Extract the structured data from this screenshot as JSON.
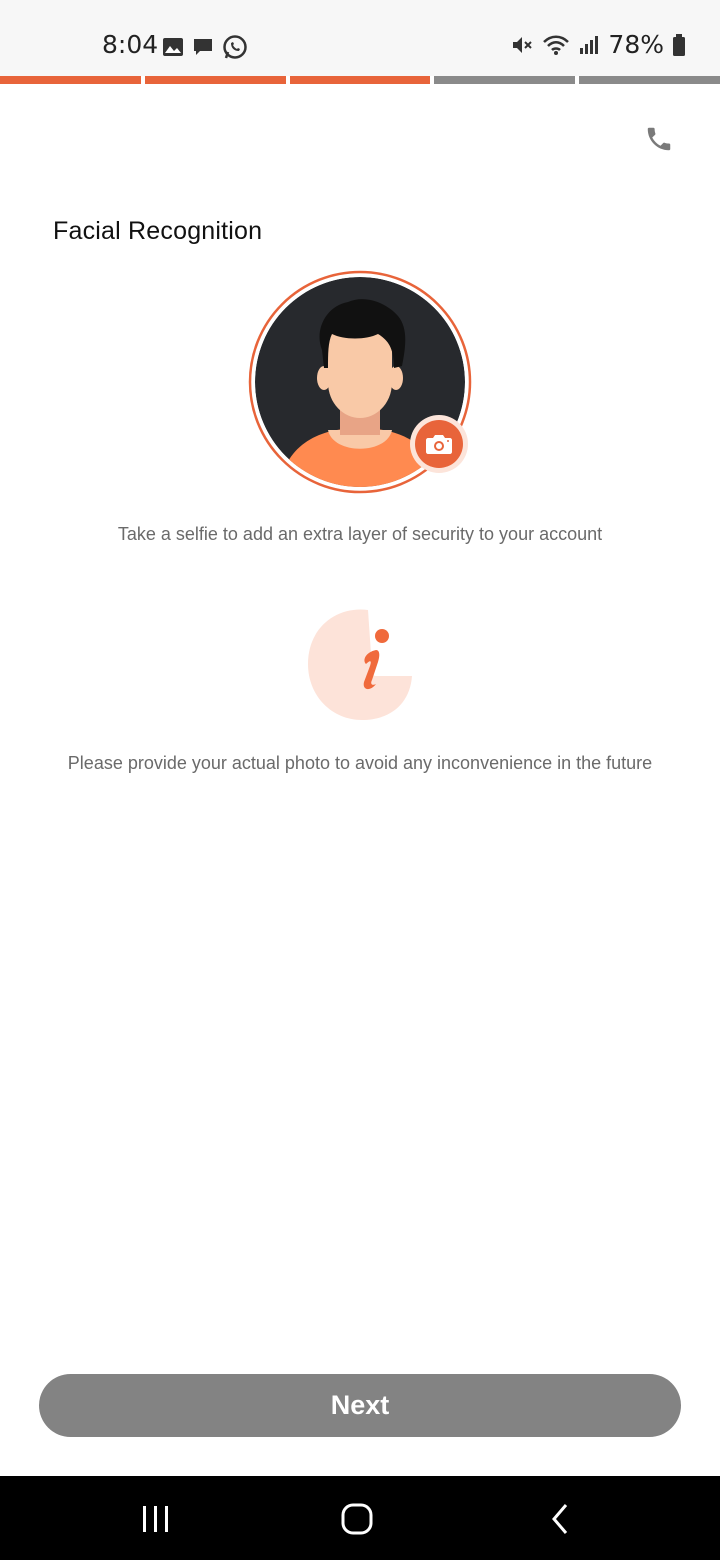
{
  "status_bar": {
    "time": "8:04",
    "battery": "78%",
    "left_icons": [
      "gallery-icon",
      "message-icon",
      "whatsapp-icon"
    ],
    "right_icons": [
      "mute-icon",
      "wifi-icon",
      "signal-icon",
      "battery-icon"
    ]
  },
  "progress": {
    "total_steps": 5,
    "completed_steps": 3,
    "active_color": "#e8643a",
    "inactive_color": "#8a8a8a"
  },
  "header": {
    "call_icon": "phone-icon"
  },
  "main": {
    "title": "Facial Recognition",
    "avatar_icon": "user-avatar",
    "camera_icon": "camera-icon",
    "subtitle": "Take a selfie to add an extra layer of security to your account",
    "info_icon": "info-icon",
    "note": "Please provide your actual photo to avoid any inconvenience in the future"
  },
  "footer": {
    "next_label": "Next"
  },
  "nav_bar": {
    "items": [
      "recent-apps-icon",
      "home-icon",
      "back-icon"
    ]
  },
  "colors": {
    "accent": "#e8643a",
    "button_bg": "#838383",
    "avatar_bg": "#27292d",
    "shirt": "#ff8a50",
    "skin": "#f9c9a7",
    "info_bg": "#fde3d9"
  }
}
